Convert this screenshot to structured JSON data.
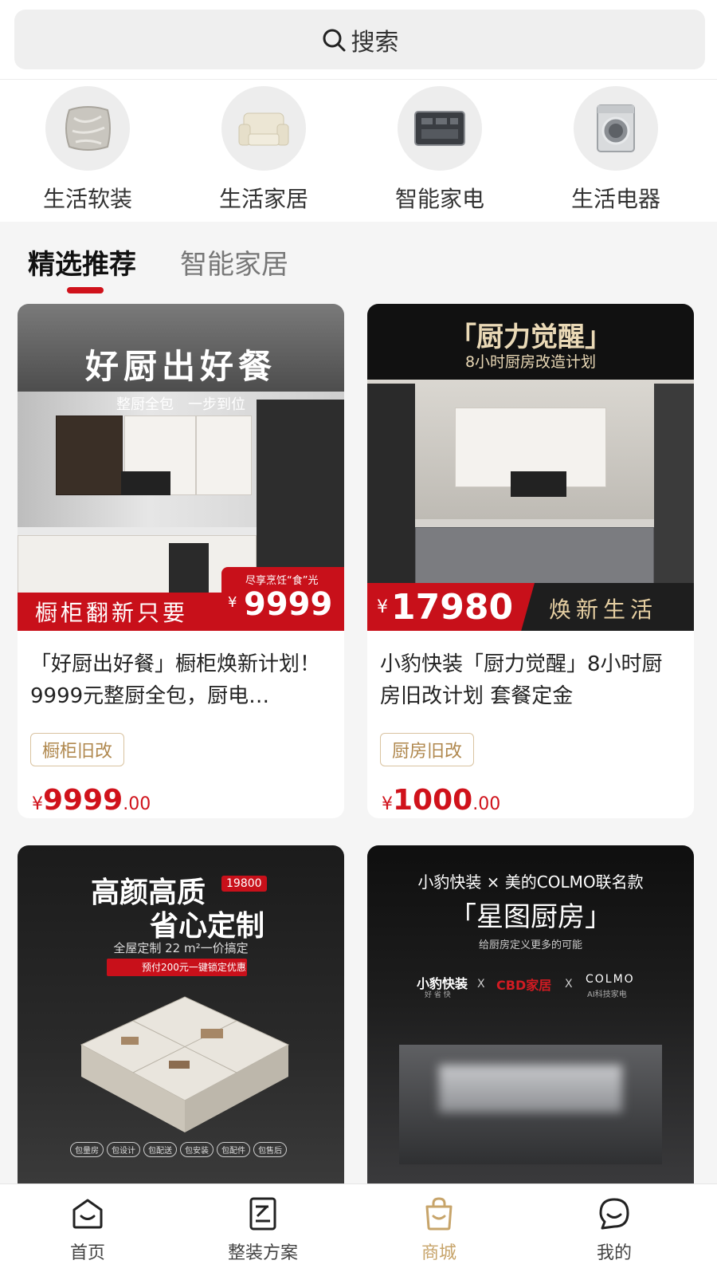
{
  "search": {
    "label": "搜索"
  },
  "categories": [
    {
      "label": "生活软装",
      "icon": "pillow-icon"
    },
    {
      "label": "生活家居",
      "icon": "armchair-icon"
    },
    {
      "label": "智能家电",
      "icon": "smart-panel-icon"
    },
    {
      "label": "生活电器",
      "icon": "washing-machine-icon"
    }
  ],
  "tabs": [
    {
      "label": "精选推荐",
      "active": true
    },
    {
      "label": "智能家居",
      "active": false
    }
  ],
  "products": [
    {
      "banner": {
        "headline": "好厨出好餐",
        "sub": "整厨全包　一步到位",
        "badge_small": "尽享烹饪“食”光",
        "ribbon": "橱柜翻新只要",
        "ribbon_price": "9999",
        "currency": "¥"
      },
      "title": "「好厨出好餐」橱柜焕新计划！9999元整厨全包，厨电…",
      "tag": "橱柜旧改",
      "price": {
        "currency": "¥",
        "integer": "9999",
        "decimal": ".00"
      }
    },
    {
      "banner": {
        "headline": "「厨力觉醒」",
        "sub": "8小时厨房改造计划",
        "ribbon_price": "17980",
        "currency": "¥",
        "ribbon": "焕新生活"
      },
      "title": "小豹快装「厨力觉醒」8小时厨房旧改计划 套餐定金",
      "tag": "厨房旧改",
      "price": {
        "currency": "¥",
        "integer": "1000",
        "decimal": ".00"
      }
    },
    {
      "banner": {
        "headline1": "高颜高质",
        "headline2": "省心定制",
        "badge": "19800",
        "sub": "全屋定制 22 m²一价搞定",
        "promo": "预付200元一键锁定优惠",
        "pills": [
          "包量房",
          "包设计",
          "包配送",
          "包安装",
          "包配件",
          "包售后"
        ]
      }
    },
    {
      "banner": {
        "top": "小豹快装 × 美的COLMO联名款",
        "headline": "「星图厨房」",
        "sub": "给厨房定义更多的可能",
        "brand1": "小豹快装",
        "brand1_sub": "好 省 快",
        "brand2": "CBD家居",
        "brand3": "COLMO",
        "brand3_sub": "AI科技家电",
        "x": "X"
      }
    }
  ],
  "nav": [
    {
      "label": "首页",
      "icon": "home-icon",
      "active": false
    },
    {
      "label": "整装方案",
      "icon": "document-icon",
      "active": false
    },
    {
      "label": "商城",
      "icon": "shopping-bag-icon",
      "active": true
    },
    {
      "label": "我的",
      "icon": "chat-profile-icon",
      "active": false
    }
  ],
  "colors": {
    "accent_red": "#d0121b",
    "gold": "#c7a46a",
    "tag_gold": "#b0884e"
  }
}
